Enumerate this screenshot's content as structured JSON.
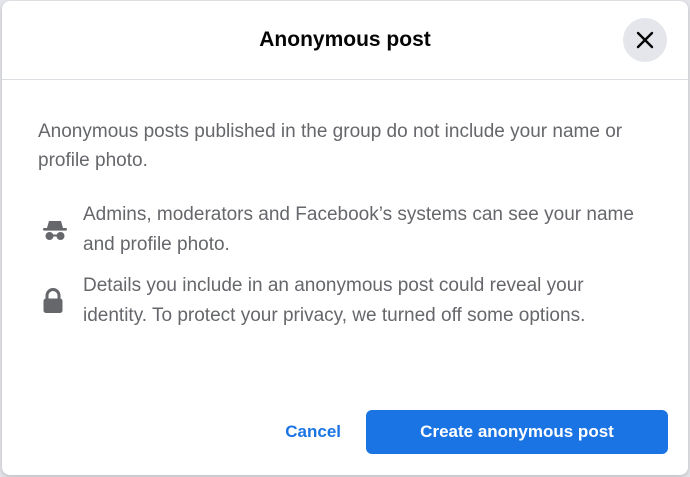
{
  "dialog": {
    "title": "Anonymous post",
    "close_icon": "close-icon",
    "intro": "Anonymous posts published in the group do not include your name or profile photo.",
    "items": [
      {
        "icon": "incognito-icon",
        "text": "Admins, moderators and Facebook’s systems can see your name and profile photo."
      },
      {
        "icon": "lock-icon",
        "text": "Details you include in an anonymous post could reveal your identity. To protect your privacy, we turned off some options."
      }
    ],
    "cancel_label": "Cancel",
    "primary_label": "Create anonymous post"
  },
  "colors": {
    "accent": "#1b74e4",
    "secondary_text": "#65676b",
    "close_button_bg": "#e4e6eb"
  }
}
